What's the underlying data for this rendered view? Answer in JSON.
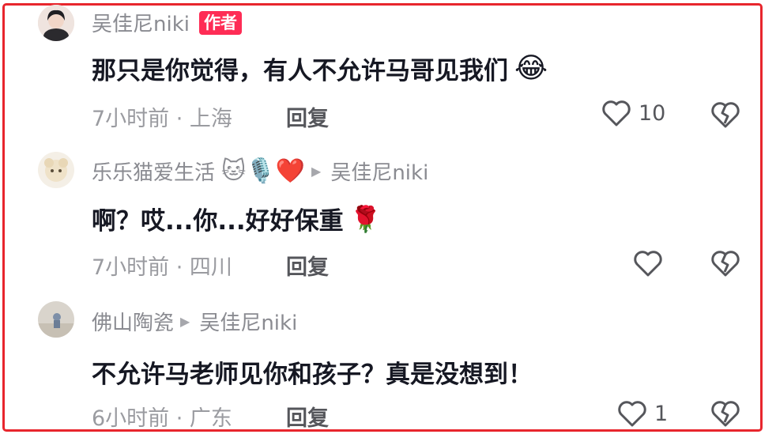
{
  "comments": [
    {
      "username": "吴佳尼niki",
      "badge": "作者",
      "text": "那只是你觉得，有人不允许马哥见我们",
      "text_emoji": "😂",
      "time_location": "7小时前 · 上海",
      "reply_label": "回复",
      "likes": "10"
    },
    {
      "username": "乐乐猫爱生活",
      "name_emojis": "🐱🎙️❤️",
      "reply_to": "吴佳尼niki",
      "text": "啊？哎...你...好好保重",
      "text_emoji": "🌹",
      "time_location": "7小时前 · 四川",
      "reply_label": "回复",
      "likes": ""
    },
    {
      "username": "佛山陶瓷",
      "reply_to": "吴佳尼niki",
      "text": "不允许马老师见你和孩子？真是没想到！",
      "time_location": "6小时前 · 广东",
      "reply_label": "回复",
      "likes": "1"
    }
  ],
  "icons": {
    "like": "heart-outline-icon",
    "dislike": "broken-heart-icon",
    "reply_arrow": "triangle-right-icon"
  },
  "colors": {
    "border": "#e8262d",
    "badge": "#fe2c55",
    "muted": "#8a8b91"
  }
}
